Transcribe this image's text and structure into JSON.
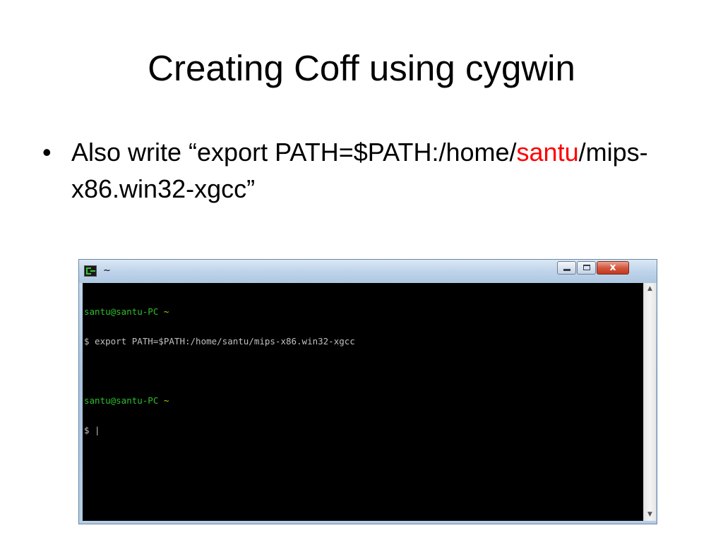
{
  "slide": {
    "title": "Creating Coff using cygwin",
    "bullet": {
      "dot": "•",
      "text_before": "Also write “export PATH=$PATH:/home/",
      "highlight": "santu",
      "text_after": "/mips-x86.win32-xgcc”"
    }
  },
  "window": {
    "title": "~",
    "icon": "cygwin-terminal-icon",
    "controls": {
      "minimize_icon": "minimize-icon",
      "maximize_icon": "maximize-icon",
      "close_label": "x"
    }
  },
  "terminal": {
    "prompt1_user": "santu@santu-PC",
    "prompt1_dir": "~",
    "command": "$ export PATH=$PATH:/home/santu/mips-x86.win32-xgcc",
    "prompt2_user": "santu@santu-PC",
    "prompt2_dir": "~",
    "current_input": "$ |"
  },
  "scrollbar": {
    "up_glyph": "▲",
    "down_glyph": "▼"
  },
  "colors": {
    "highlight": "#ff0000",
    "prompt_user": "#2fbf2f",
    "prompt_dir": "#c8c800",
    "console_bg": "#000000"
  }
}
